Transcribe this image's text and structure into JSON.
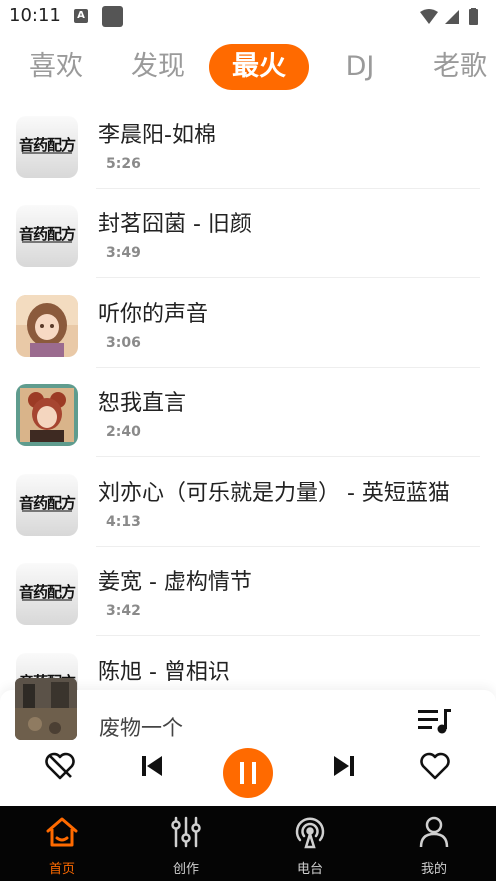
{
  "status": {
    "time": "10:11",
    "notif_icon": "A"
  },
  "tabs": [
    {
      "label": "喜欢",
      "active": false
    },
    {
      "label": "发现",
      "active": false
    },
    {
      "label": "最火",
      "active": true
    },
    {
      "label": "DJ",
      "active": false
    },
    {
      "label": "老歌",
      "active": false
    }
  ],
  "songs": [
    {
      "title": "李晨阳-如棉",
      "duration": "5:26",
      "cover": "logo"
    },
    {
      "title": "封茗囧菌 - 旧颜",
      "duration": "3:49",
      "cover": "logo"
    },
    {
      "title": "听你的声音",
      "duration": "3:06",
      "cover": "anime-girl"
    },
    {
      "title": "恕我直言",
      "duration": "2:40",
      "cover": "anime-girl-2"
    },
    {
      "title": "刘亦心（可乐就是力量） - 英短蓝猫",
      "duration": "4:13",
      "cover": "logo"
    },
    {
      "title": "姜宽 - 虚构情节",
      "duration": "3:42",
      "cover": "logo"
    },
    {
      "title": "陈旭 - 曾相识",
      "duration": "",
      "cover": "logo"
    }
  ],
  "logo_text": "音药配方",
  "player": {
    "title": "废物一个",
    "accent": "#ff6a00",
    "icons": [
      "dislike-heart-icon",
      "previous-icon",
      "pause-icon",
      "next-icon",
      "heart-icon",
      "playlist-icon"
    ]
  },
  "bottom_nav": [
    {
      "label": "首页",
      "icon": "home-icon",
      "active": true
    },
    {
      "label": "创作",
      "icon": "sliders-icon",
      "active": false
    },
    {
      "label": "电台",
      "icon": "radio-icon",
      "active": false
    },
    {
      "label": "我的",
      "icon": "profile-icon",
      "active": false
    }
  ]
}
